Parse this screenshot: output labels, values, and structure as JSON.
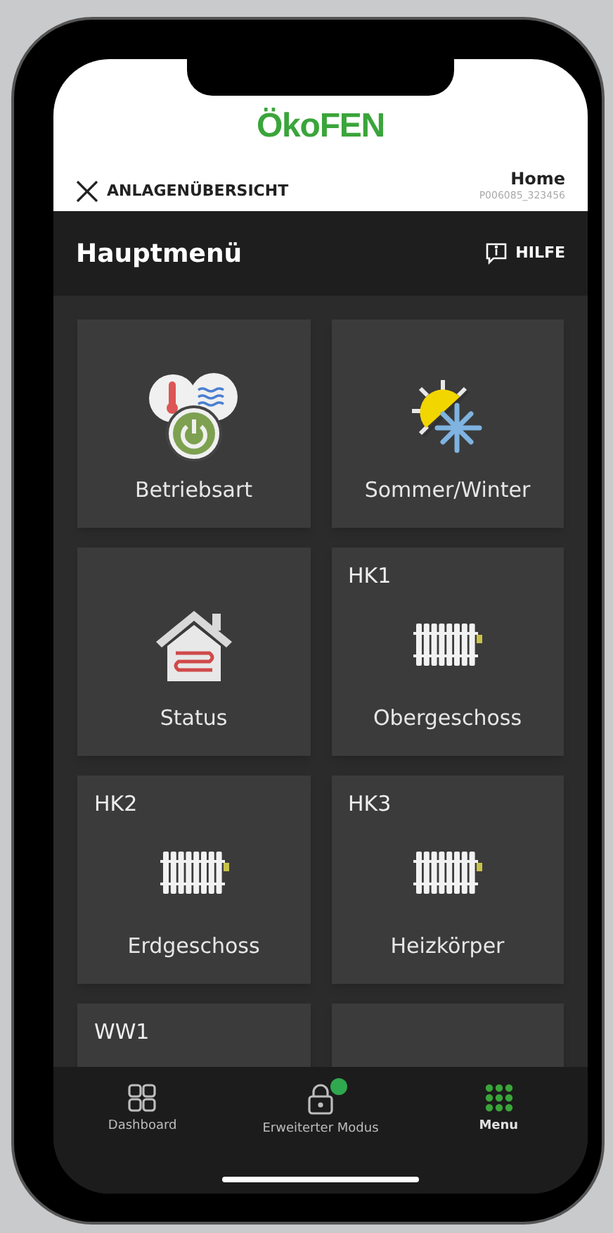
{
  "header": {
    "logo": "ÖkoFEN",
    "back_label": "ANLAGENÜBERSICHT",
    "site_name": "Home",
    "serial": "P006085_323456"
  },
  "title_bar": {
    "title": "Hauptmenü",
    "help": "HILFE"
  },
  "tiles": [
    {
      "kind": "mode",
      "label": "Betriebsart"
    },
    {
      "kind": "season",
      "label": "Sommer/Winter"
    },
    {
      "kind": "house",
      "label": "Status"
    },
    {
      "kind": "radiator",
      "tag": "HK1",
      "label": "Obergeschoss"
    },
    {
      "kind": "radiator",
      "tag": "HK2",
      "label": "Erdgeschoss"
    },
    {
      "kind": "radiator",
      "tag": "HK3",
      "label": "Heizkörper"
    },
    {
      "kind": "partial",
      "tag": "WW1"
    },
    {
      "kind": "partial"
    }
  ],
  "nav": [
    {
      "kind": "dashboard",
      "label": "Dashboard",
      "selected": false,
      "indicator": false
    },
    {
      "kind": "lock",
      "label": "Erweiterter Modus",
      "selected": false,
      "indicator": true
    },
    {
      "kind": "grid",
      "label": "Menu",
      "selected": true,
      "indicator": false
    }
  ]
}
